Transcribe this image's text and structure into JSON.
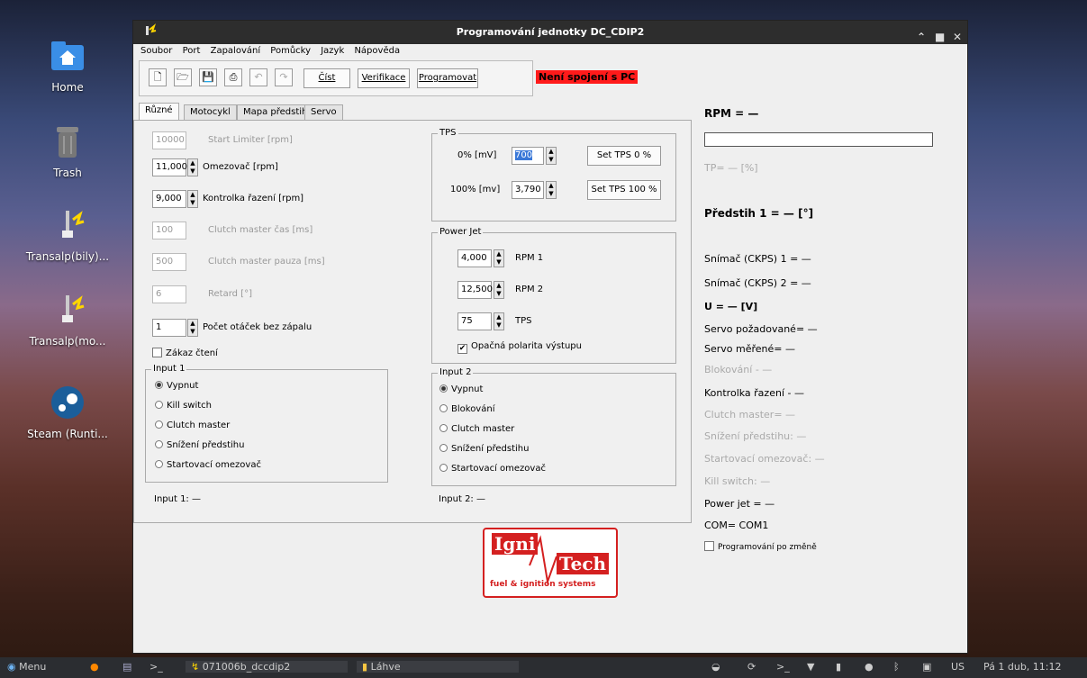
{
  "desktop": {
    "icons": [
      {
        "label": "Home"
      },
      {
        "label": "Trash"
      },
      {
        "label": "Transalp(bily)..."
      },
      {
        "label": "Transalp(mo..."
      },
      {
        "label": "Steam (Runti..."
      }
    ]
  },
  "window": {
    "title": "Programování jednotky DC_CDIP2"
  },
  "menu": [
    "Soubor",
    "Port",
    "Zapalování",
    "Pomůcky",
    "Jazyk",
    "Nápověda"
  ],
  "toolbar": {
    "read": "Číst",
    "verify": "Verifikace",
    "program": "Programovat",
    "status": "Není spojení s PC"
  },
  "tabs": [
    "Různé",
    "Motocykl",
    "Mapa předstihu",
    "Servo"
  ],
  "left": {
    "start_limiter": {
      "value": "10000",
      "label": "Start Limiter [rpm]"
    },
    "limiter": {
      "value": "11,000",
      "label": "Omezovač [rpm]"
    },
    "shift_light": {
      "value": "9,000",
      "label": "Kontrolka řazení [rpm]"
    },
    "clutch_time": {
      "value": "100",
      "label": "Clutch master čas [ms]"
    },
    "clutch_pause": {
      "value": "500",
      "label": "Clutch master pauza [ms]"
    },
    "retard": {
      "value": "6",
      "label": "Retard [°]"
    },
    "no_spark": {
      "value": "1",
      "label": "Počet otáček bez zápalu"
    },
    "no_read": "Zákaz čtení"
  },
  "tps": {
    "title": "TPS",
    "zero_label": "0% [mV]",
    "zero_value": "700",
    "full_label": "100% [mv]",
    "full_value": "3,790",
    "set0": "Set TPS 0 %",
    "set100": "Set TPS 100 %"
  },
  "powerjet": {
    "title": "Power Jet",
    "rpm1_value": "4,000",
    "rpm1_label": "RPM 1",
    "rpm2_value": "12,500",
    "rpm2_label": "RPM 2",
    "tps_value": "75",
    "tps_label": "TPS",
    "polarity": "Opačná polarita výstupu"
  },
  "input1": {
    "title": "Input 1",
    "options": [
      "Vypnut",
      "Kill switch",
      "Clutch master",
      "Snížení předstihu",
      "Startovací omezovač"
    ],
    "status": "Input 1: —"
  },
  "input2": {
    "title": "Input 2",
    "options": [
      "Vypnut",
      "Blokování",
      "Clutch master",
      "Snížení předstihu",
      "Startovací omezovač"
    ],
    "status": "Input 2: —"
  },
  "logo": {
    "line1": "Igni",
    "line2": "Tech",
    "sub": "fuel & ignition systems"
  },
  "right": {
    "rpm": "RPM = —",
    "tp": "TP= — [%]",
    "advance": "Předstih 1 = — [°]",
    "ckps1": "Snímač (CKPS) 1 = —",
    "ckps2": "Snímač (CKPS) 2 = —",
    "u": "U = — [V]",
    "servo_req": "Servo požadované= —",
    "servo_meas": "Servo měřené= —",
    "block": "Blokování - —",
    "shift": "Kontrolka řazení - —",
    "clutch": "Clutch master= —",
    "retard": "Snížení předstihu: —",
    "start_lim": "Startovací omezovač: —",
    "kill": "Kill switch: —",
    "powerjet": "Power jet = —",
    "com": "COM= COM1",
    "prog_change": "Programování po změně"
  },
  "taskbar": {
    "menu": "Menu",
    "task1": "071006b_dccdip2",
    "task2": "Láhve",
    "lang": "US",
    "clock": "Pá 1 dub, 11:12"
  },
  "colors": {
    "status_bg": "#ff1a1a",
    "logo_red": "#d42020",
    "titlebar": "#2d2d2d"
  }
}
